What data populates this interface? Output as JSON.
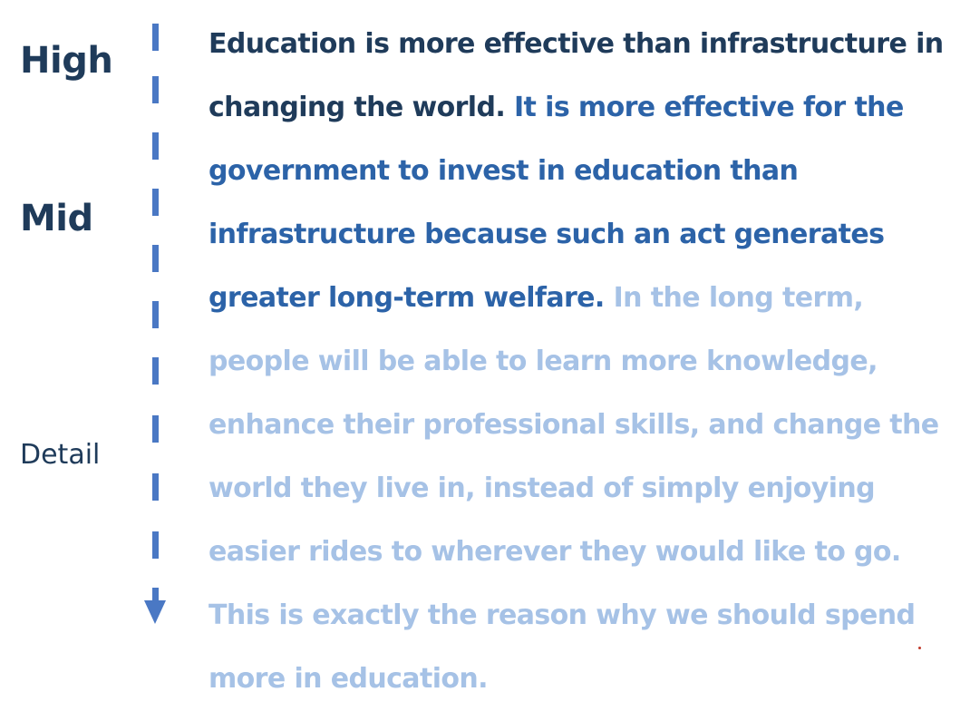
{
  "levels": {
    "high": "High",
    "mid": "Mid",
    "detail": "Detail"
  },
  "paragraph": {
    "high_text": "Education is more effective than infrastructure in changing the world.",
    "mid_text": "It is more effective for the government to invest in education than infrastructure because such an act generates greater long-term welfare.",
    "detail_text": "In the long term, people will be able to learn more knowledge, enhance their professional skills, and change the world they live in, instead of simply enjoying easier rides to wherever they would like to go. This is exactly the reason why we should spend more in education."
  },
  "colors": {
    "high": "#1f3b5a",
    "mid": "#2c63a8",
    "detail": "#a6c2e6",
    "arrow": "#4a78c4"
  }
}
